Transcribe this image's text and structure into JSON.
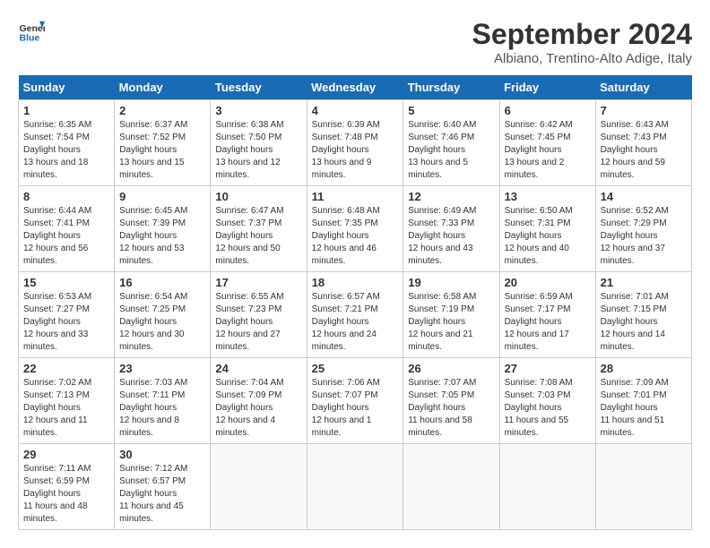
{
  "header": {
    "logo_line1": "General",
    "logo_line2": "Blue",
    "month_title": "September 2024",
    "location": "Albiano, Trentino-Alto Adige, Italy"
  },
  "weekdays": [
    "Sunday",
    "Monday",
    "Tuesday",
    "Wednesday",
    "Thursday",
    "Friday",
    "Saturday"
  ],
  "weeks": [
    [
      {
        "num": "1",
        "sunrise": "6:35 AM",
        "sunset": "7:54 PM",
        "daylight": "13 hours and 18 minutes."
      },
      {
        "num": "2",
        "sunrise": "6:37 AM",
        "sunset": "7:52 PM",
        "daylight": "13 hours and 15 minutes."
      },
      {
        "num": "3",
        "sunrise": "6:38 AM",
        "sunset": "7:50 PM",
        "daylight": "13 hours and 12 minutes."
      },
      {
        "num": "4",
        "sunrise": "6:39 AM",
        "sunset": "7:48 PM",
        "daylight": "13 hours and 9 minutes."
      },
      {
        "num": "5",
        "sunrise": "6:40 AM",
        "sunset": "7:46 PM",
        "daylight": "13 hours and 5 minutes."
      },
      {
        "num": "6",
        "sunrise": "6:42 AM",
        "sunset": "7:45 PM",
        "daylight": "13 hours and 2 minutes."
      },
      {
        "num": "7",
        "sunrise": "6:43 AM",
        "sunset": "7:43 PM",
        "daylight": "12 hours and 59 minutes."
      }
    ],
    [
      {
        "num": "8",
        "sunrise": "6:44 AM",
        "sunset": "7:41 PM",
        "daylight": "12 hours and 56 minutes."
      },
      {
        "num": "9",
        "sunrise": "6:45 AM",
        "sunset": "7:39 PM",
        "daylight": "12 hours and 53 minutes."
      },
      {
        "num": "10",
        "sunrise": "6:47 AM",
        "sunset": "7:37 PM",
        "daylight": "12 hours and 50 minutes."
      },
      {
        "num": "11",
        "sunrise": "6:48 AM",
        "sunset": "7:35 PM",
        "daylight": "12 hours and 46 minutes."
      },
      {
        "num": "12",
        "sunrise": "6:49 AM",
        "sunset": "7:33 PM",
        "daylight": "12 hours and 43 minutes."
      },
      {
        "num": "13",
        "sunrise": "6:50 AM",
        "sunset": "7:31 PM",
        "daylight": "12 hours and 40 minutes."
      },
      {
        "num": "14",
        "sunrise": "6:52 AM",
        "sunset": "7:29 PM",
        "daylight": "12 hours and 37 minutes."
      }
    ],
    [
      {
        "num": "15",
        "sunrise": "6:53 AM",
        "sunset": "7:27 PM",
        "daylight": "12 hours and 33 minutes."
      },
      {
        "num": "16",
        "sunrise": "6:54 AM",
        "sunset": "7:25 PM",
        "daylight": "12 hours and 30 minutes."
      },
      {
        "num": "17",
        "sunrise": "6:55 AM",
        "sunset": "7:23 PM",
        "daylight": "12 hours and 27 minutes."
      },
      {
        "num": "18",
        "sunrise": "6:57 AM",
        "sunset": "7:21 PM",
        "daylight": "12 hours and 24 minutes."
      },
      {
        "num": "19",
        "sunrise": "6:58 AM",
        "sunset": "7:19 PM",
        "daylight": "12 hours and 21 minutes."
      },
      {
        "num": "20",
        "sunrise": "6:59 AM",
        "sunset": "7:17 PM",
        "daylight": "12 hours and 17 minutes."
      },
      {
        "num": "21",
        "sunrise": "7:01 AM",
        "sunset": "7:15 PM",
        "daylight": "12 hours and 14 minutes."
      }
    ],
    [
      {
        "num": "22",
        "sunrise": "7:02 AM",
        "sunset": "7:13 PM",
        "daylight": "12 hours and 11 minutes."
      },
      {
        "num": "23",
        "sunrise": "7:03 AM",
        "sunset": "7:11 PM",
        "daylight": "12 hours and 8 minutes."
      },
      {
        "num": "24",
        "sunrise": "7:04 AM",
        "sunset": "7:09 PM",
        "daylight": "12 hours and 4 minutes."
      },
      {
        "num": "25",
        "sunrise": "7:06 AM",
        "sunset": "7:07 PM",
        "daylight": "12 hours and 1 minute."
      },
      {
        "num": "26",
        "sunrise": "7:07 AM",
        "sunset": "7:05 PM",
        "daylight": "11 hours and 58 minutes."
      },
      {
        "num": "27",
        "sunrise": "7:08 AM",
        "sunset": "7:03 PM",
        "daylight": "11 hours and 55 minutes."
      },
      {
        "num": "28",
        "sunrise": "7:09 AM",
        "sunset": "7:01 PM",
        "daylight": "11 hours and 51 minutes."
      }
    ],
    [
      {
        "num": "29",
        "sunrise": "7:11 AM",
        "sunset": "6:59 PM",
        "daylight": "11 hours and 48 minutes."
      },
      {
        "num": "30",
        "sunrise": "7:12 AM",
        "sunset": "6:57 PM",
        "daylight": "11 hours and 45 minutes."
      },
      null,
      null,
      null,
      null,
      null
    ]
  ]
}
